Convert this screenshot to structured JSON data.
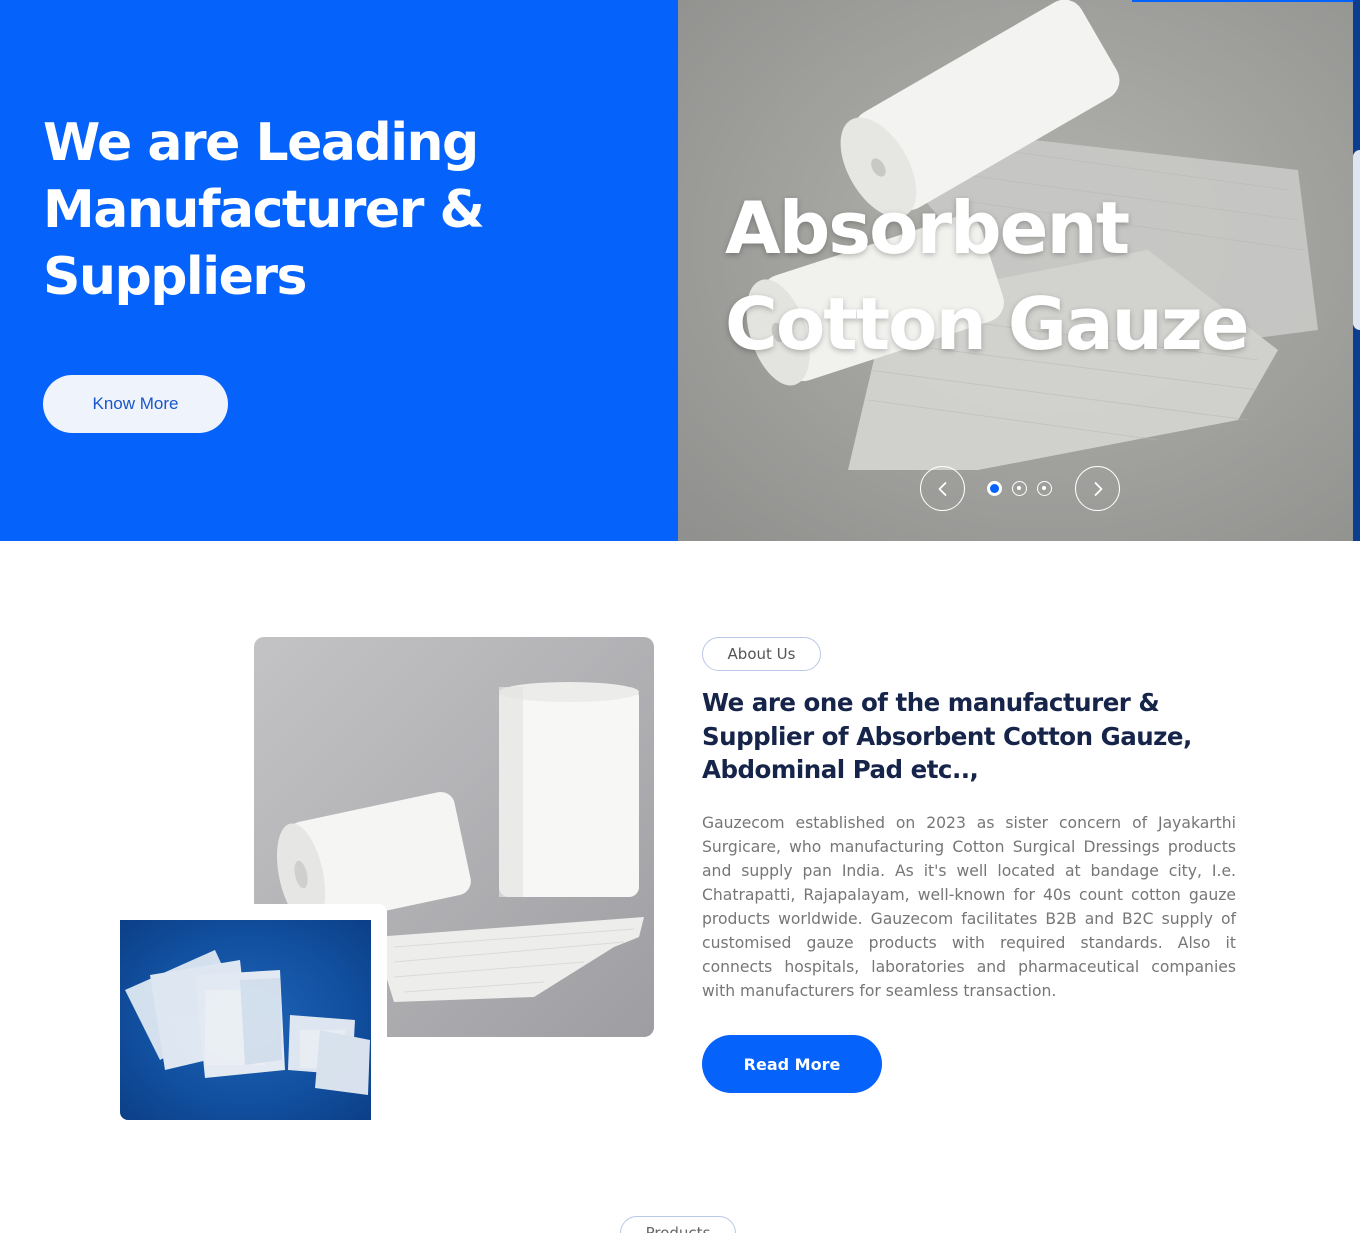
{
  "hero": {
    "title": "We are Leading Manufacturer & Suppliers",
    "cta_label": "Know More",
    "slider": {
      "slide_title": "Absorbent Cotton Gauze",
      "dots_total": 3,
      "active_dot": 1,
      "prev_icon": "chevron-left-icon",
      "next_icon": "chevron-right-icon"
    }
  },
  "about": {
    "tag": "About Us",
    "heading": "We are one of the manufacturer & Supplier of Absorbent Cotton Gauze, Abdominal Pad etc..,",
    "body": "Gauzecom established on 2023 as sister concern of Jayakarthi Surgicare, who manufacturing Cotton Surgical Dressings products and supply pan India. As it's well located at bandage city, I.e. Chatrapatti, Rajapalayam, well-known for 40s count cotton gauze products worldwide. Gauzecom facilitates B2B and B2C supply of customised gauze products with required standards. Also it connects hospitals, laboratories and pharmaceutical companies with manufacturers for seamless transaction.",
    "cta_label": "Read More"
  },
  "products": {
    "tag": "Products"
  },
  "colors": {
    "brand_blue": "#0562fb",
    "heading_navy": "#16244a",
    "body_gray": "#767676"
  }
}
